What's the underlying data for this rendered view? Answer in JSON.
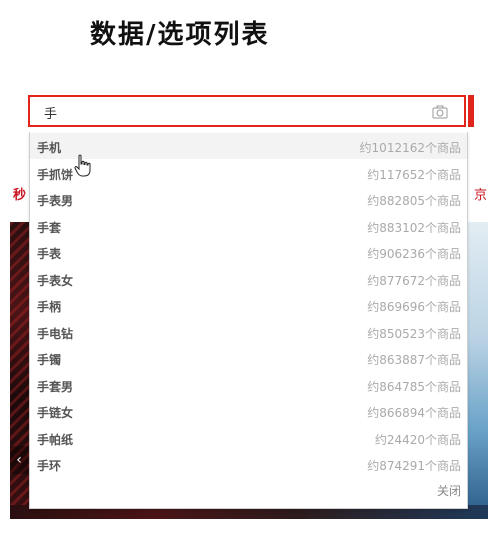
{
  "heading": "数据/选项列表",
  "search": {
    "value": "手"
  },
  "background": {
    "tab_left": "秒",
    "tab_right": "京",
    "arrow_left": "‹"
  },
  "suggestions": [
    {
      "name": "手机",
      "count": "约1012162个商品"
    },
    {
      "name": "手抓饼",
      "count": "约117652个商品"
    },
    {
      "name": "手表男",
      "count": "约882805个商品"
    },
    {
      "name": "手套",
      "count": "约883102个商品"
    },
    {
      "name": "手表",
      "count": "约906236个商品"
    },
    {
      "name": "手表女",
      "count": "约877672个商品"
    },
    {
      "name": "手柄",
      "count": "约869696个商品"
    },
    {
      "name": "手电钻",
      "count": "约850523个商品"
    },
    {
      "name": "手镯",
      "count": "约863887个商品"
    },
    {
      "name": "手套男",
      "count": "约864785个商品"
    },
    {
      "name": "手链女",
      "count": "约866894个商品"
    },
    {
      "name": "手帕纸",
      "count": "约24420个商品"
    },
    {
      "name": "手环",
      "count": "约874291个商品"
    }
  ],
  "close_label": "关闭",
  "icons": {
    "camera": "camera-icon",
    "cursor": "hand-cursor-icon"
  },
  "colors": {
    "accent": "#e1251b",
    "active_row": "#f3f3f3"
  }
}
